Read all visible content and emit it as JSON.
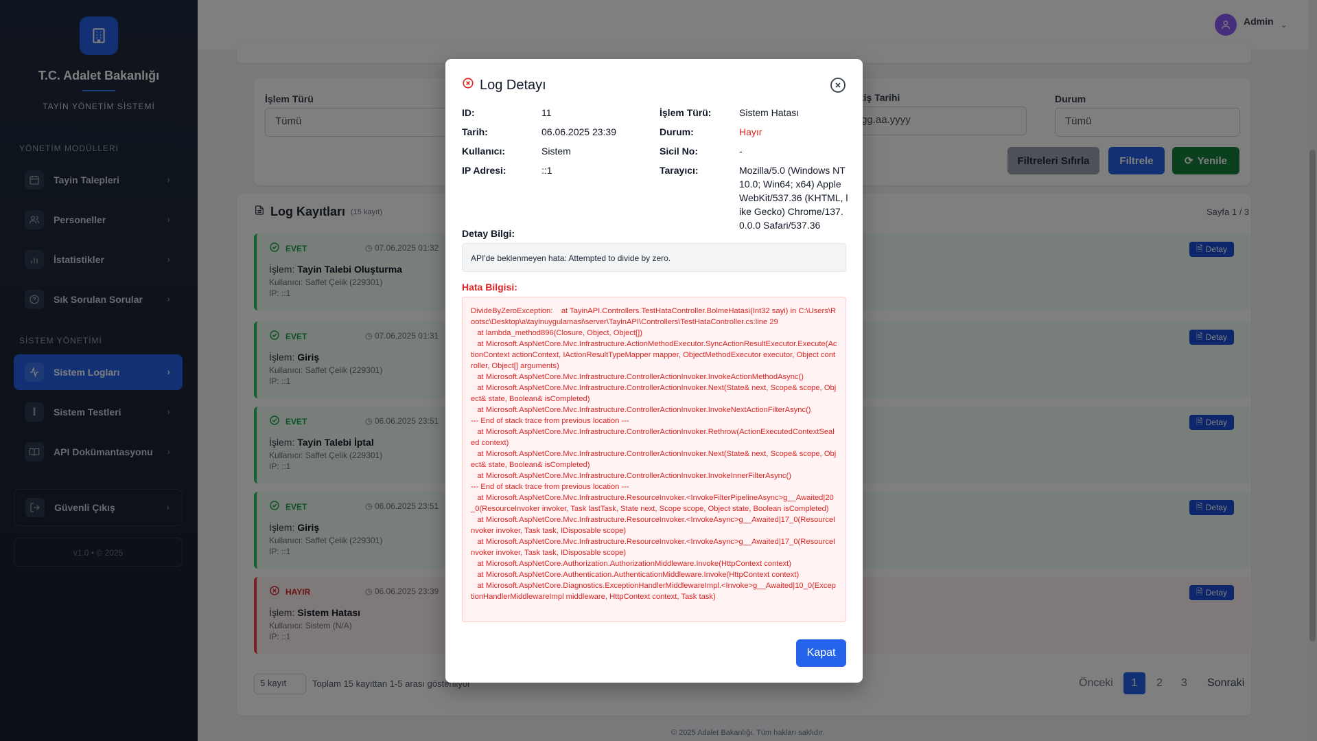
{
  "sidebar": {
    "brand": "T.C. Adalet Bakanlığı",
    "subtitle": "TAYİN YÖNETİM SİSTEMİ",
    "section1": "YÖNETİM MODÜLLERİ",
    "section2": "SİSTEM YÖNETİMİ",
    "items": [
      {
        "label": "Tayin Talepleri",
        "icon": "calendar-icon"
      },
      {
        "label": "Personeller",
        "icon": "users-icon"
      },
      {
        "label": "İstatistikler",
        "icon": "bar-chart-icon"
      },
      {
        "label": "Sık Sorulan Sorular",
        "icon": "question-icon"
      },
      {
        "label": "Sistem Logları",
        "icon": "activity-icon",
        "active": true
      },
      {
        "label": "Sistem Testleri",
        "icon": "test-tube-icon"
      },
      {
        "label": "API Dokümantasyonu",
        "icon": "book-icon"
      }
    ],
    "logout": "Güvenli Çıkış",
    "version": "v1.0 • © 2025"
  },
  "topbar": {
    "user": "Admin"
  },
  "filters": {
    "operation_type_label": "İşlem Türü",
    "operation_type_value": "Tümü",
    "end_date_label": "Bitiş Tarihi",
    "end_date_placeholder": "gg.aa.yyyy",
    "status_label": "Durum",
    "status_value": "Tümü",
    "reset_button": "Filtreleri Sıfırla",
    "filter_button": "Filtrele",
    "refresh_button": "Yenile"
  },
  "logs": {
    "title": "Log Kayıtları",
    "count": "(15 kayıt)",
    "page_info": "Sayfa 1 / 3",
    "detail_label": "Detay",
    "items": [
      {
        "status": "EVET",
        "time": "07.06.2025 01:32",
        "op_prefix": "İşlem:",
        "op": "Tayin Talebi Oluşturma",
        "user": "Kullanıcı: Saffet Çelik (229301)",
        "ip": "IP: ::1",
        "ok": true
      },
      {
        "status": "EVET",
        "time": "07.06.2025 01:31",
        "op_prefix": "İşlem:",
        "op": "Giriş",
        "user": "Kullanıcı: Saffet Çelik (229301)",
        "ip": "IP: ::1",
        "ok": true
      },
      {
        "status": "EVET",
        "time": "06.06.2025 23:51",
        "op_prefix": "İşlem:",
        "op": "Tayin Talebi İptal",
        "user": "Kullanıcı: Saffet Çelik (229301)",
        "ip": "IP: ::1",
        "ok": true
      },
      {
        "status": "EVET",
        "time": "06.06.2025 23:51",
        "op_prefix": "İşlem:",
        "op": "Giriş",
        "user": "Kullanıcı: Saffet Çelik (229301)",
        "ip": "IP: ::1",
        "ok": true
      },
      {
        "status": "HAYIR",
        "time": "06.06.2025 23:39",
        "op_prefix": "İşlem:",
        "op": "Sistem Hatası",
        "user": "Kullanıcı: Sistem (N/A)",
        "ip": "IP: ::1",
        "ok": false
      }
    ]
  },
  "pagination": {
    "page_size": "5 kayıt",
    "summary": "Toplam 15 kayıttan 1-5 arası gösteriliyor",
    "prev": "Önceki",
    "pages": [
      "1",
      "2",
      "3"
    ],
    "next": "Sonraki"
  },
  "footer": "© 2025 Adalet Bakanlığı. Tüm hakları saklıdır.",
  "modal": {
    "title": "Log Detayı",
    "id_label": "ID:",
    "id_value": "11",
    "date_label": "Tarih:",
    "date_value": "06.06.2025 23:39",
    "user_label": "Kullanıcı:",
    "user_value": "Sistem",
    "ip_label": "IP Adresi:",
    "ip_value": "::1",
    "op_label": "İşlem Türü:",
    "op_value": "Sistem Hatası",
    "status_label": "Durum:",
    "status_value": "Hayır",
    "sicil_label": "Sicil No:",
    "sicil_value": "-",
    "browser_label": "Tarayıcı:",
    "browser_value": "Mozilla/5.0 (Windows NT 10.0; Win64; x64) AppleWebKit/537.36 (KHTML, like Gecko) Chrome/137.0.0.0 Safari/537.36",
    "detail_title": "Detay Bilgi:",
    "detail_value": "API'de beklenmeyen hata: Attempted to divide by zero.",
    "error_title": "Hata Bilgisi:",
    "error_value": "DivideByZeroException:    at TayinAPI.Controllers.TestHataController.BolmeHatasi(Int32 sayi) in C:\\Users\\Rootsc\\Desktop\\a\\tayinuygulamasi\\server\\TayinAPI\\Controllers\\TestHataController.cs:line 29\n   at lambda_method896(Closure, Object, Object[])\n   at Microsoft.AspNetCore.Mvc.Infrastructure.ActionMethodExecutor.SyncActionResultExecutor.Execute(ActionContext actionContext, IActionResultTypeMapper mapper, ObjectMethodExecutor executor, Object controller, Object[] arguments)\n   at Microsoft.AspNetCore.Mvc.Infrastructure.ControllerActionInvoker.InvokeActionMethodAsync()\n   at Microsoft.AspNetCore.Mvc.Infrastructure.ControllerActionInvoker.Next(State& next, Scope& scope, Object& state, Boolean& isCompleted)\n   at Microsoft.AspNetCore.Mvc.Infrastructure.ControllerActionInvoker.InvokeNextActionFilterAsync()\n--- End of stack trace from previous location ---\n   at Microsoft.AspNetCore.Mvc.Infrastructure.ControllerActionInvoker.Rethrow(ActionExecutedContextSealed context)\n   at Microsoft.AspNetCore.Mvc.Infrastructure.ControllerActionInvoker.Next(State& next, Scope& scope, Object& state, Boolean& isCompleted)\n   at Microsoft.AspNetCore.Mvc.Infrastructure.ControllerActionInvoker.InvokeInnerFilterAsync()\n--- End of stack trace from previous location ---\n   at Microsoft.AspNetCore.Mvc.Infrastructure.ResourceInvoker.<InvokeFilterPipelineAsync>g__Awaited|20_0(ResourceInvoker invoker, Task lastTask, State next, Scope scope, Object state, Boolean isCompleted)\n   at Microsoft.AspNetCore.Mvc.Infrastructure.ResourceInvoker.<InvokeAsync>g__Awaited|17_0(ResourceInvoker invoker, Task task, IDisposable scope)\n   at Microsoft.AspNetCore.Mvc.Infrastructure.ResourceInvoker.<InvokeAsync>g__Awaited|17_0(ResourceInvoker invoker, Task task, IDisposable scope)\n   at Microsoft.AspNetCore.Authorization.AuthorizationMiddleware.Invoke(HttpContext context)\n   at Microsoft.AspNetCore.Authentication.AuthenticationMiddleware.Invoke(HttpContext context)\n   at Microsoft.AspNetCore.Diagnostics.ExceptionHandlerMiddlewareImpl.<Invoke>g__Awaited|10_0(ExceptionHandlerMiddlewareImpl middleware, HttpContext context, Task task)",
    "close_button": "Kapat"
  },
  "colors": {
    "primary": "#2563eb",
    "success": "#16a34a",
    "danger": "#dc2626",
    "refresh": "#15803d",
    "sidebar": "#1f2a3c"
  }
}
